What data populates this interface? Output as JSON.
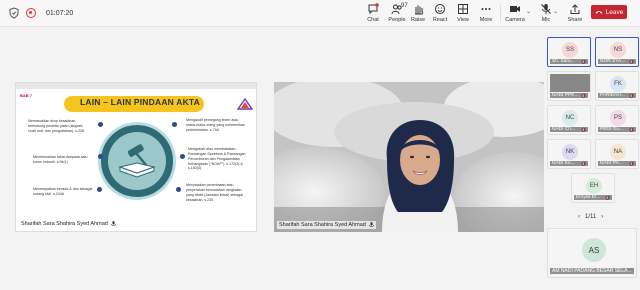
{
  "toolbar": {
    "timer": "01:07:20",
    "chat_label": "Chat",
    "people_label": "People",
    "people_count": "97",
    "raise_label": "Raise",
    "react_label": "React",
    "view_label": "View",
    "more_label": "More",
    "camera_label": "Camera",
    "mic_label": "Mic",
    "share_label": "Share",
    "leave_label": "Leave"
  },
  "shared_screen": {
    "presenter": "Sharifah Sara Shahira Syed Ahmad",
    "slide": {
      "tag": "BAB 7",
      "title": "LAIN – LAIN PINDAAN AKTA",
      "left_items": [
        "Memasukkan skop kesalahan berhubung perantis palsu (skypart, chatt root, dan pengubahan). s.238",
        "Membenarkan fakta daripada satu forum industri. s.94(1)",
        "Menempatkan semula & dan sebagai hutang sivil. s.244A"
      ],
      "right_items": [
        "Mengaudit pemegang lesen atau mana-mana orang yang memberikan perkhidmatan. s.74A",
        "Mengubah atau membatalkan Rancangan Spektrum & Rancangan Penomboran dan Pengalamatan Kebangsaan (\"NOAP\"). s.172(3) & s.183(4)",
        "Menyatakan penerimaan atau penyerahan kemudahan rangkaian yang dibeli (Jawatan kekal) sebagai kesalahan. s.235"
      ]
    }
  },
  "camera": {
    "name": "Sharifah Sara Shahira Syed Ahmad"
  },
  "participants": [
    {
      "initials": "SS",
      "name": "Sh. Sara...",
      "active": true,
      "color": "#f4d9d6"
    },
    {
      "initials": "NS",
      "name": "NOR SYA...",
      "active": true,
      "color": "#f4d9d6"
    },
    {
      "initials": "",
      "name": "NADI PPK...",
      "active": false,
      "color": "#888888"
    },
    {
      "initials": "FK",
      "name": "FARIDAH...",
      "active": false,
      "color": "#d6e6f4"
    },
    {
      "initials": "NC",
      "name": "NADI Ch...",
      "active": false,
      "color": "#d9ecec"
    },
    {
      "initials": "PS",
      "name": "PEDI Gu...",
      "active": false,
      "color": "#f4d9e6"
    },
    {
      "initials": "NK",
      "name": "NADI Ke...",
      "active": false,
      "color": "#dcdaf0"
    },
    {
      "initials": "NA",
      "name": "NADI PA...",
      "active": false,
      "color": "#f4e6cf"
    },
    {
      "initials": "EH",
      "name": "Emylia El...",
      "active": false,
      "color": "#d6ecd6"
    }
  ],
  "pager": {
    "text": "1/11"
  },
  "featured": {
    "initials": "AS",
    "name": "AM NADI PADANG BESAR SELA..."
  }
}
